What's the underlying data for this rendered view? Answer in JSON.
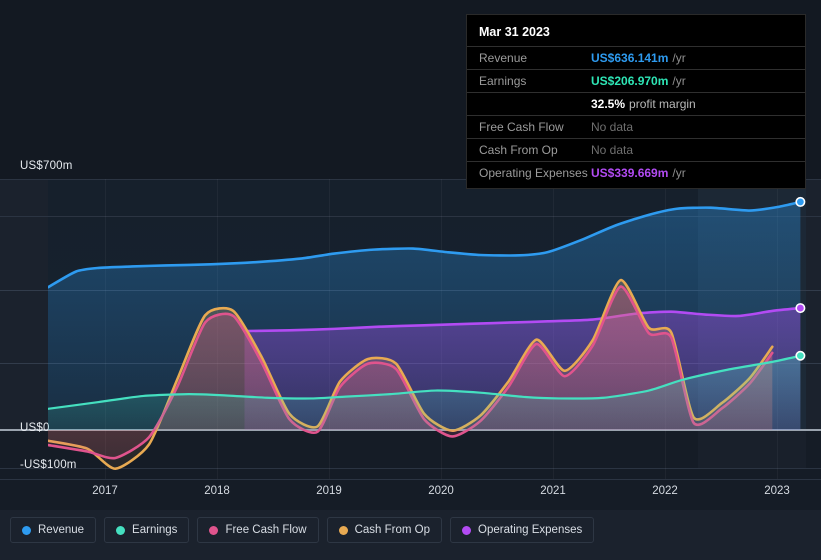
{
  "tooltip": {
    "title": "Mar 31 2023",
    "rows": [
      {
        "label": "Revenue",
        "value": "US$636.141m",
        "unit": "/yr",
        "color": "#2e9bf0",
        "no_data": false
      },
      {
        "label": "Earnings",
        "value": "US$206.970m",
        "unit": "/yr",
        "color": "#2ee6b6",
        "no_data": false
      },
      {
        "label": "",
        "value": "32.5%",
        "unit": "profit margin",
        "color": "#ffffff",
        "no_data": false,
        "is_margin": true
      },
      {
        "label": "Free Cash Flow",
        "value": "No data",
        "unit": "",
        "color": "#6f6f6f",
        "no_data": true
      },
      {
        "label": "Cash From Op",
        "value": "No data",
        "unit": "",
        "color": "#6f6f6f",
        "no_data": true
      },
      {
        "label": "Operating Expenses",
        "value": "US$339.669m",
        "unit": "/yr",
        "color": "#b24bf3",
        "no_data": false
      }
    ]
  },
  "legend": [
    {
      "label": "Revenue",
      "color": "#2e9bf0"
    },
    {
      "label": "Earnings",
      "color": "#45e0c0"
    },
    {
      "label": "Free Cash Flow",
      "color": "#e0548d"
    },
    {
      "label": "Cash From Op",
      "color": "#e8aa52"
    },
    {
      "label": "Operating Expenses",
      "color": "#b24bf3"
    }
  ],
  "axis": {
    "y_top_label": "US$700m",
    "y_zero_label": "US$0",
    "y_neg_label": "-US$100m",
    "x_labels": [
      "2017",
      "2018",
      "2019",
      "2020",
      "2021",
      "2022",
      "2023"
    ]
  },
  "chart_data": {
    "type": "area",
    "title": "",
    "xlabel": "",
    "ylabel": "US$",
    "ylim": [
      -100,
      700
    ],
    "xlim": [
      2016.55,
      2023.3
    ],
    "grid": true,
    "legend_position": "bottom-left",
    "unit": "US$m per year",
    "y_ticks": [
      700,
      600,
      400,
      200,
      0,
      -100
    ],
    "y_tick_labels": [
      "US$700m",
      "",
      "",
      "",
      "US$0",
      "-US$100m"
    ],
    "x_ticks": [
      2017,
      2018,
      2019,
      2020,
      2021,
      2022,
      2023
    ],
    "forecast_region_start": 2022.45,
    "series": [
      {
        "name": "Revenue",
        "color": "#2e9bf0",
        "x": [
          2016.55,
          2016.8,
          2017.0,
          2017.3,
          2017.6,
          2018.0,
          2018.4,
          2018.8,
          2019.1,
          2019.45,
          2019.8,
          2020.1,
          2020.4,
          2020.75,
          2021.0,
          2021.3,
          2021.6,
          2021.9,
          2022.15,
          2022.45,
          2022.8,
          2023.05,
          2023.25
        ],
        "values": [
          398,
          442,
          452,
          456,
          459,
          462,
          468,
          478,
          492,
          503,
          506,
          496,
          488,
          487,
          496,
          530,
          570,
          600,
          617,
          620,
          612,
          622,
          636
        ]
      },
      {
        "name": "Earnings",
        "color": "#45e0c0",
        "x": [
          2016.55,
          2017.0,
          2017.4,
          2017.8,
          2018.1,
          2018.5,
          2018.9,
          2019.2,
          2019.6,
          2020.0,
          2020.4,
          2020.8,
          2021.1,
          2021.5,
          2021.9,
          2022.2,
          2022.6,
          2023.0,
          2023.25
        ],
        "values": [
          59,
          78,
          95,
          100,
          97,
          90,
          88,
          93,
          100,
          110,
          104,
          92,
          88,
          90,
          110,
          140,
          168,
          190,
          207
        ]
      },
      {
        "name": "Free Cash Flow",
        "color": "#e0548d",
        "x": [
          2016.55,
          2016.9,
          2017.15,
          2017.45,
          2017.7,
          2017.95,
          2018.2,
          2018.45,
          2018.7,
          2018.95,
          2019.15,
          2019.4,
          2019.65,
          2019.9,
          2020.15,
          2020.4,
          2020.65,
          2020.9,
          2021.15,
          2021.4,
          2021.65,
          2021.9,
          2022.1,
          2022.3,
          2022.55,
          2022.8,
          2023.0
        ],
        "values": [
          -42,
          -60,
          -78,
          -20,
          120,
          300,
          318,
          190,
          30,
          -5,
          120,
          185,
          170,
          30,
          -18,
          25,
          120,
          240,
          150,
          235,
          400,
          270,
          258,
          20,
          60,
          130,
          215
        ]
      },
      {
        "name": "Cash From Op",
        "color": "#e8aa52",
        "x": [
          2016.55,
          2016.9,
          2017.15,
          2017.45,
          2017.7,
          2017.95,
          2018.2,
          2018.45,
          2018.7,
          2018.95,
          2019.15,
          2019.4,
          2019.65,
          2019.9,
          2020.15,
          2020.4,
          2020.65,
          2020.9,
          2021.15,
          2021.4,
          2021.65,
          2021.9,
          2022.1,
          2022.3,
          2022.55,
          2022.8,
          2023.0
        ],
        "values": [
          -30,
          -52,
          -108,
          -40,
          140,
          320,
          332,
          205,
          45,
          10,
          135,
          198,
          185,
          45,
          -2,
          40,
          135,
          252,
          165,
          250,
          418,
          285,
          272,
          35,
          75,
          145,
          232
        ]
      },
      {
        "name": "Operating Expenses",
        "color": "#b24bf3",
        "x": [
          2018.3,
          2018.7,
          2019.1,
          2019.5,
          2019.9,
          2020.3,
          2020.7,
          2021.0,
          2021.4,
          2021.8,
          2022.1,
          2022.4,
          2022.7,
          2023.0,
          2023.25
        ],
        "values": [
          276,
          278,
          282,
          288,
          292,
          296,
          300,
          303,
          308,
          325,
          330,
          322,
          318,
          332,
          340
        ]
      }
    ],
    "endpoint_markers": [
      {
        "series": "Revenue",
        "x": 2023.25,
        "value": 636
      },
      {
        "series": "Operating Expenses",
        "x": 2023.25,
        "value": 340
      },
      {
        "series": "Earnings",
        "x": 2023.25,
        "value": 207
      }
    ]
  }
}
